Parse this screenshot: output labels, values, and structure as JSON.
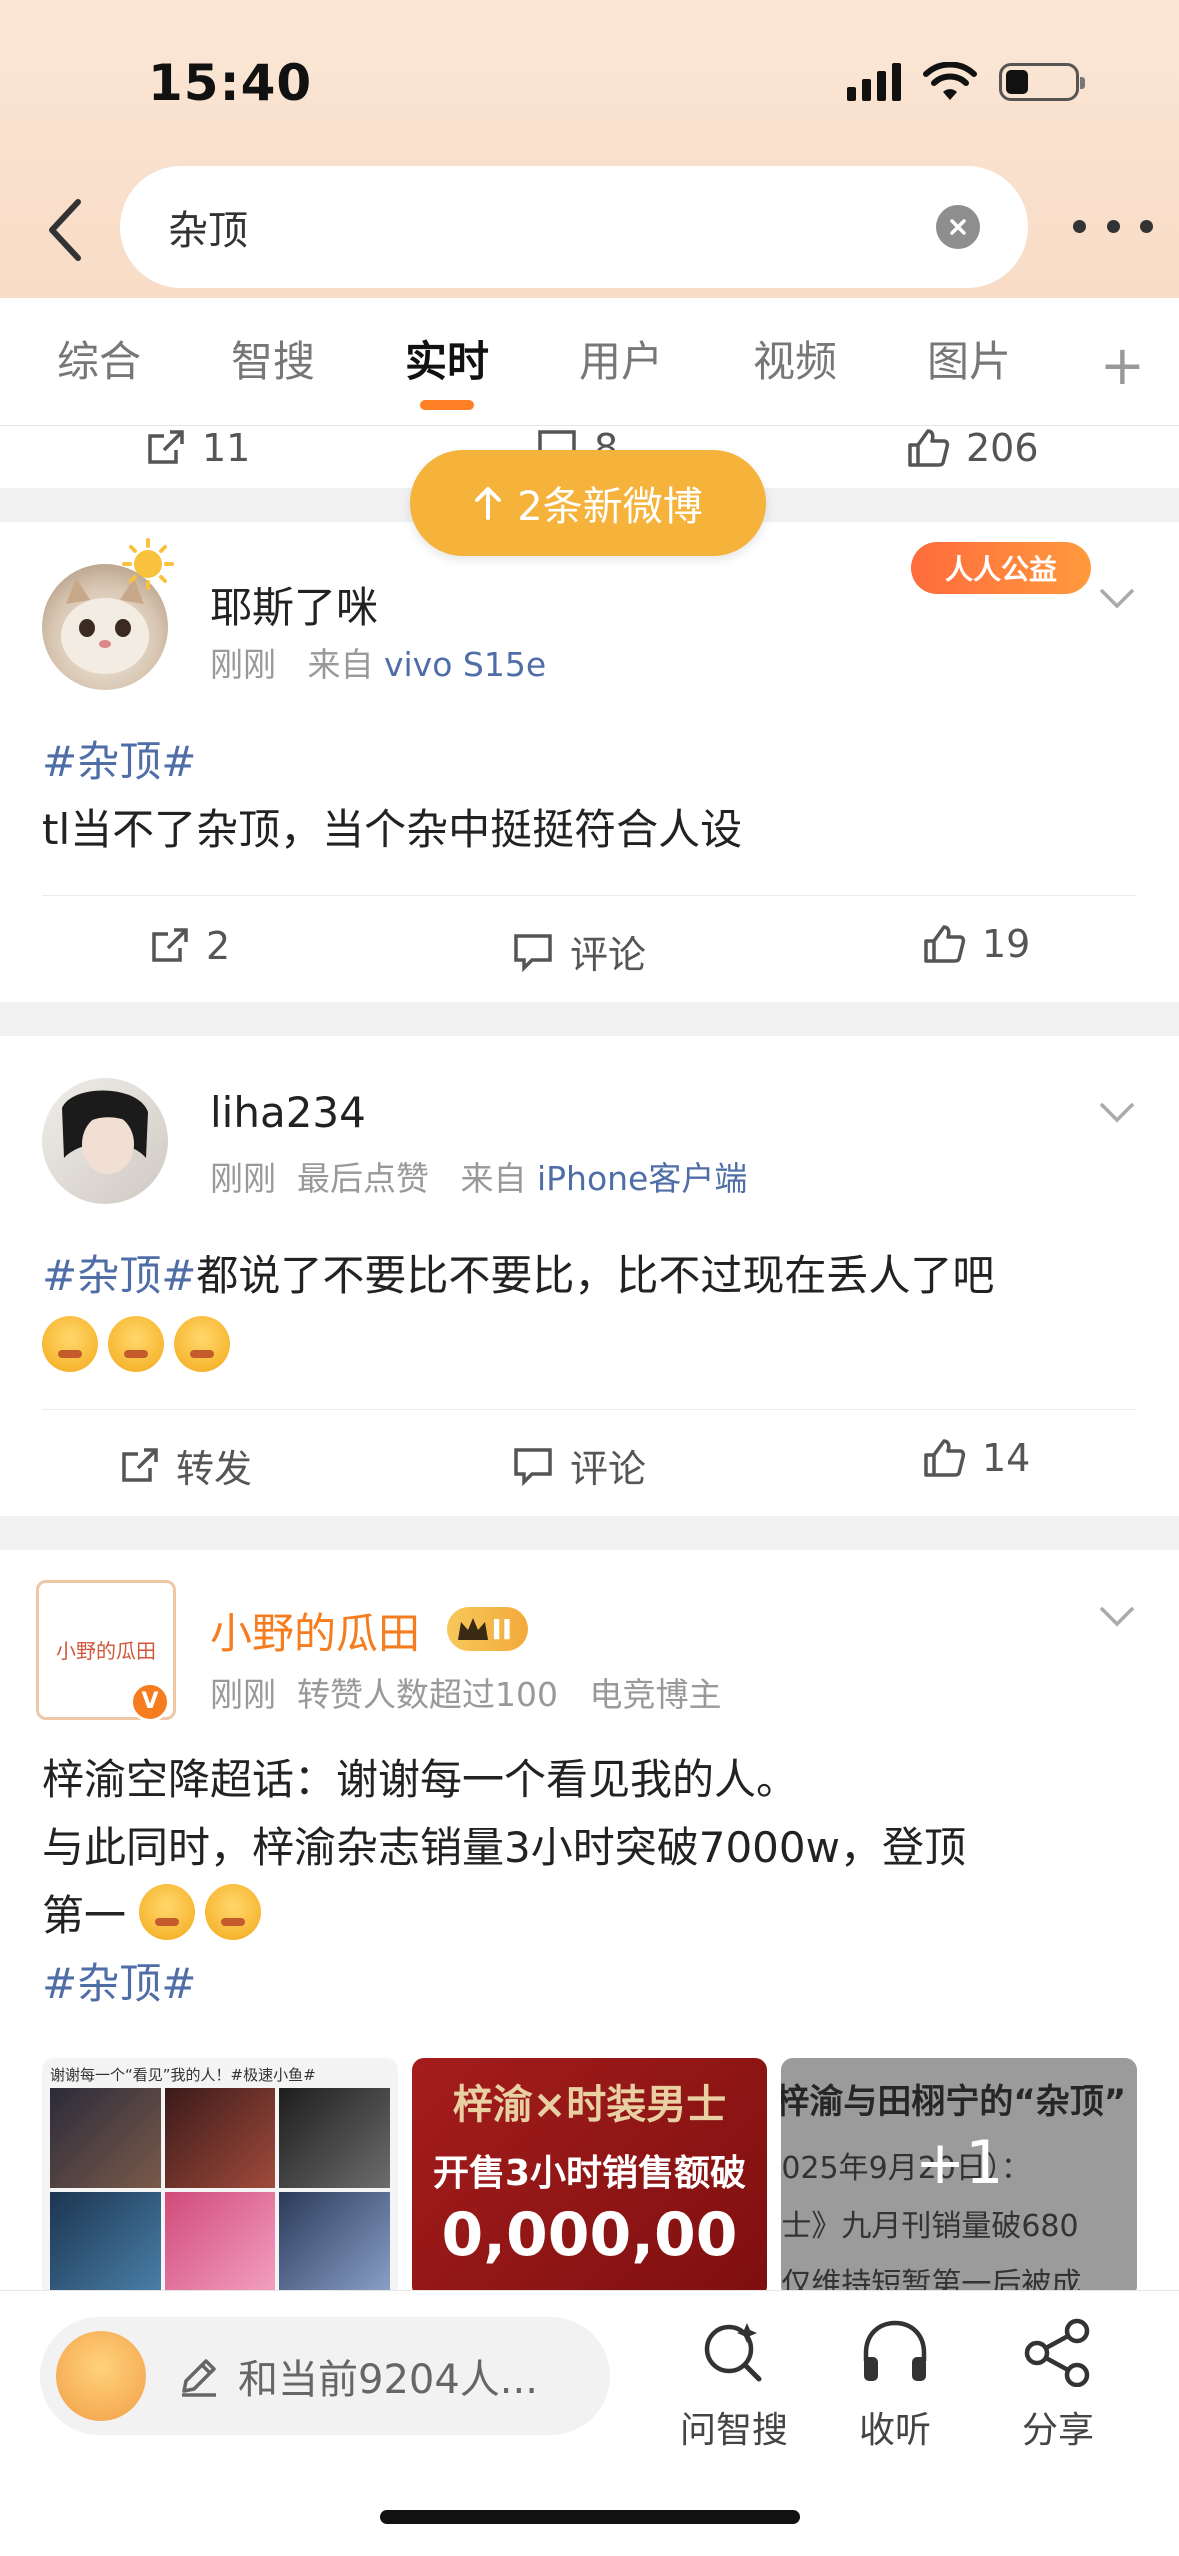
{
  "status": {
    "time": "15:40"
  },
  "search": {
    "query": "杂顶"
  },
  "tabs": [
    "综合",
    "智搜",
    "实时",
    "用户",
    "视频",
    "图片"
  ],
  "tab_plus": "+",
  "prev_post": {
    "repost_count": "11",
    "comment_count": "8",
    "like_count": "206"
  },
  "new_posts_pill": "2条新微博",
  "posts": [
    {
      "username": "耶斯了咪",
      "time": "刚刚",
      "source_prefix": "来自",
      "source": "vivo S15e",
      "badge": "人人公益",
      "topic": "#杂顶#",
      "text": "tl当不了杂顶，当个杂中挺挺符合人设",
      "repost": "2",
      "comment": "评论",
      "like": "19"
    },
    {
      "username": "liha234",
      "time": "刚刚",
      "extra": "最后点赞",
      "source_prefix": "来自",
      "source": "iPhone客户端",
      "topic": "#杂顶#",
      "text": "都说了不要比不要比，比不过现在丢人了吧",
      "repost": "转发",
      "comment": "评论",
      "like": "14"
    },
    {
      "username": "小野的瓜田",
      "avatar_text": "小野的瓜田",
      "vip_level": "II",
      "time": "刚刚",
      "extra": "转赞人数超过100",
      "role": "电竞博主",
      "line1": "梓渝空降超话：谢谢每一个看见我的人。",
      "line2": "与此同时，梓渝杂志销量3小时突破7000w，登顶",
      "line3": "第一",
      "topic": "#杂顶#",
      "img1_caption": "谢谢每一个“看见”我的人！#极速小鱼#",
      "img2_title": "梓渝×时装男士",
      "img2_sub": "开售3小时销售额破",
      "img2_big": "0,000,00",
      "img3_title": "梓渝与田栩宁的“杂顶”",
      "img3_l1": "025年9月20日）：",
      "img3_l2": "士》九月刊销量破680",
      "img3_l3": "仅维持短暂第一后被成",
      "img_more": "+1"
    }
  ],
  "bottom": {
    "compose_placeholder": "和当前9204人...",
    "ai_search": "问智搜",
    "listen": "收听",
    "share": "分享"
  },
  "colors": {
    "accent": "#ff7f24",
    "pill": "#f5b33c",
    "link": "#4f6ea7",
    "vip": "#f57c1f"
  }
}
